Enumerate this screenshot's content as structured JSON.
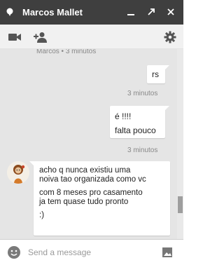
{
  "window": {
    "title": "Marcos Mallet",
    "status_color": "#ffffff",
    "titlebar_color": "#3f3f3f",
    "controls": [
      "minimize-icon",
      "popout-icon",
      "close-icon"
    ]
  },
  "toolbar": {
    "left_icons": [
      "video-call-icon",
      "add-person-icon"
    ],
    "right_icons": [
      "gear-icon"
    ]
  },
  "conversation": {
    "cut_meta": "Marcos • 3 minutos",
    "outgoing": [
      {
        "lines": [
          "rs"
        ],
        "time": "3 minutos"
      },
      {
        "lines": [
          "é !!!!",
          "falta pouco"
        ],
        "time": "3 minutos"
      }
    ],
    "incoming": {
      "lines": [
        "acho q nunca existiu uma",
        "noiva tao organizada como vc",
        "com 8 meses pro casamento",
        "ja tem quase tudo pronto",
        ":)"
      ]
    }
  },
  "composer": {
    "placeholder": "Send a message",
    "emoji_icon": "emoji-icon",
    "image_icon": "image-icon"
  }
}
